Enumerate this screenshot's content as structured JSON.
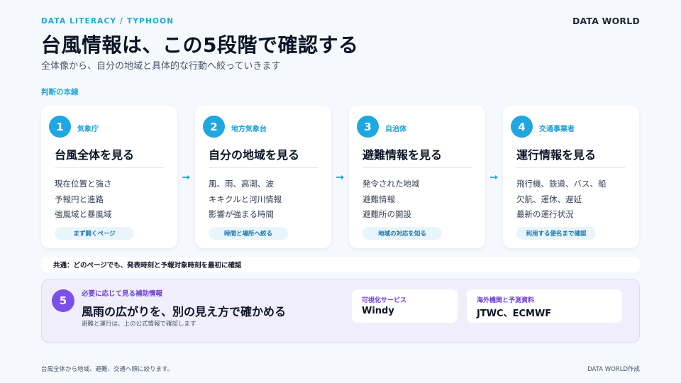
{
  "header": {
    "eyebrow": "DATA LITERACY / TYPHOON",
    "brand": "DATA WORLD",
    "title": "台風情報は、この5段階で確認する",
    "subtitle": "全体像から、自分の地域と具体的な行動へ絞っていきます"
  },
  "section_label": "判断の本線",
  "steps": [
    {
      "number": "1",
      "org": "気象庁",
      "title": "台風全体を見る",
      "items": [
        "現在位置と強さ",
        "予報円と進路",
        "強風域と暴風域"
      ],
      "tag": "まず開くページ"
    },
    {
      "number": "2",
      "org": "地方気象台",
      "title": "自分の地域を見る",
      "items": [
        "風、雨、高潮、波",
        "キキクルと河川情報",
        "影響が強まる時間"
      ],
      "tag": "時間と場所へ絞る"
    },
    {
      "number": "3",
      "org": "自治体",
      "title": "避難情報を見る",
      "items": [
        "発令された地域",
        "避難情報",
        "避難所の開設"
      ],
      "tag": "地域の対応を知る"
    },
    {
      "number": "4",
      "org": "交通事業者",
      "title": "運行情報を見る",
      "items": [
        "飛行機、鉄道、バス、船",
        "欠航、運休、遅延",
        "最新の運行状況"
      ],
      "tag": "利用する便名まで確認"
    }
  ],
  "common_note": "共通：どのページでも、発表時刻と予報対象時刻を最初に確認",
  "auxiliary": {
    "number": "5",
    "label": "必要に応じて見る補助情報",
    "title": "風雨の広がりを、別の見え方で確かめる",
    "note": "避難と運行は、上の公式情報で確認します",
    "boxes": [
      {
        "label": "可視化サービス",
        "value": "Windy"
      },
      {
        "label": "海外機関と予測資料",
        "value": "JTWC、ECMWF"
      }
    ]
  },
  "footer": {
    "left": "台風全体から地域、避難、交通へ順に絞ります。",
    "right": "DATA WORLD作成"
  },
  "colors": {
    "background": "#f5f8fc",
    "accent_blue": "#1ea7e0",
    "accent_purple": "#7c4fe8",
    "aux_background": "#f1eefc"
  },
  "icons": {
    "step_connector": "arrow-right-icon"
  }
}
